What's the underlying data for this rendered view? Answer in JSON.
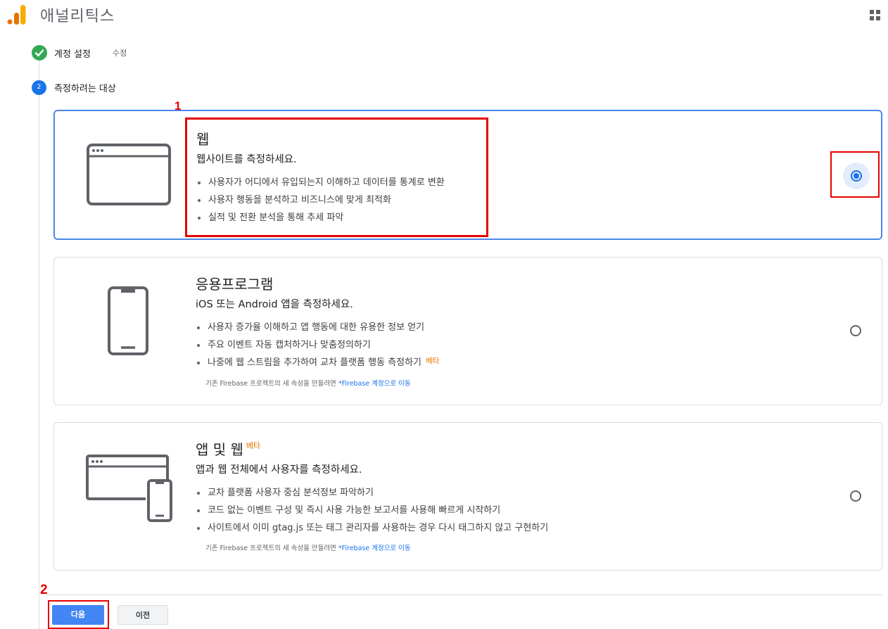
{
  "app": {
    "title": "애널리틱스"
  },
  "steps": [
    {
      "label": "계정 설정",
      "edit": "수정",
      "status": "complete"
    },
    {
      "number": "2",
      "label": "측정하려는 대상",
      "status": "active"
    }
  ],
  "options": [
    {
      "title": "웹",
      "subtitle": "웹사이트를 측정하세요.",
      "bullets": [
        "사용자가 어디에서 유입되는지 이해하고 데이터를 통계로 변환",
        "사용자 행동을 분석하고 비즈니스에 맞게 최적화",
        "실적 및 전환 분석을 통해 추세 파악"
      ],
      "selected": true,
      "icon": "browser-window-icon"
    },
    {
      "title": "응용프로그램",
      "subtitle": "iOS 또는 Android 앱을 측정하세요.",
      "bullets": [
        "사용자 증가율 이해하고 앱 행동에 대한 유용한 정보 얻기",
        "주요 이벤트 자동 캡처하거나 맞춤정의하기",
        "나중에 웹 스트림을 추가하여 교차 플랫폼 행동 측정하기"
      ],
      "bullet_badge": "베타",
      "note": "기존 Firebase 프로젝트의 새 속성을 만들려면 ",
      "note_link": "*Firebase 계정으로 이동",
      "selected": false,
      "icon": "smartphone-icon"
    },
    {
      "title": "앱 및 웹",
      "title_badge": "베타",
      "subtitle": "앱과 웹 전체에서 사용자를 측정하세요.",
      "bullets": [
        "교차 플랫폼 사용자 중심 분석정보 파악하기",
        "코드 없는 이벤트 구성 및 즉시 사용 가능한 보고서를 사용해 빠르게 시작하기",
        "사이트에서 이미 gtag.js 또는 태그 관리자를 사용하는 경우 다시 태그하지 않고 구현하기"
      ],
      "note": "기존 Firebase 프로젝트의 새 속성을 만들려면 ",
      "note_link": "*Firebase 계정으로 이동",
      "selected": false,
      "icon": "browser-and-phone-icon"
    }
  ],
  "buttons": {
    "next": "다음",
    "previous": "이전"
  },
  "annotations": {
    "label1": "1",
    "label2": "2",
    "color": "#e50000"
  },
  "colors": {
    "primary": "#4285f4",
    "selected_border": "#4a86e8",
    "success": "#34a853",
    "beta": "#e37400"
  }
}
